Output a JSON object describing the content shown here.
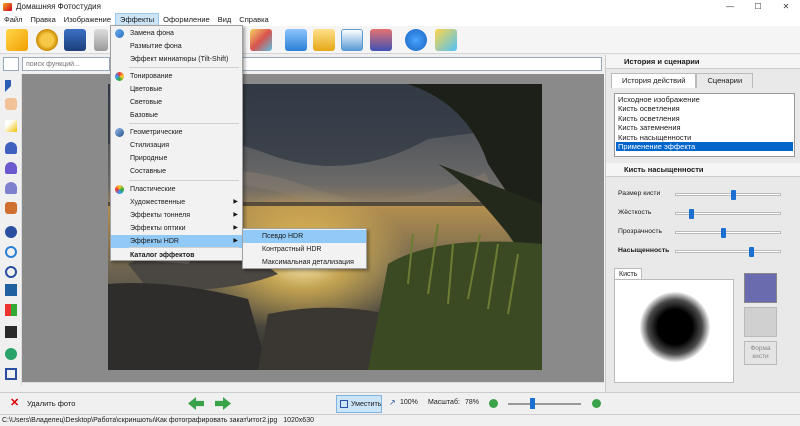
{
  "window": {
    "title": "Домашняя Фотостудия",
    "buttons": [
      "—",
      "☐",
      "✕"
    ]
  },
  "menu": {
    "items": [
      "Файл",
      "Правка",
      "Изображение",
      "Эффекты",
      "Оформление",
      "Вид",
      "Справка"
    ],
    "active_index": 3
  },
  "search": {
    "placeholder": "поиск функций..."
  },
  "effects_menu": {
    "items": [
      {
        "label": "Замена фона",
        "has_sub": false
      },
      {
        "label": "Размытие фона",
        "has_sub": false
      },
      {
        "label": "Эффект миниатюры (Tilt-Shift)",
        "has_sub": false
      },
      {
        "label": "Тонирование",
        "has_sub": false
      },
      {
        "label": "Цветовые",
        "has_sub": false
      },
      {
        "label": "Световые",
        "has_sub": false
      },
      {
        "label": "Базовые",
        "has_sub": false
      },
      {
        "label": "Геометрические",
        "has_sub": false
      },
      {
        "label": "Стилизация",
        "has_sub": false
      },
      {
        "label": "Природные",
        "has_sub": false
      },
      {
        "label": "Составные",
        "has_sub": false
      },
      {
        "label": "Пластические",
        "has_sub": false
      },
      {
        "label": "Художественные",
        "has_sub": true
      },
      {
        "label": "Эффекты тоннеля",
        "has_sub": true
      },
      {
        "label": "Эффекты оптики",
        "has_sub": true
      },
      {
        "label": "Эффекты HDR",
        "has_sub": true
      },
      {
        "label": "Каталог эффектов",
        "has_sub": false
      }
    ],
    "highlighted": "Эффекты HDR"
  },
  "hdr_submenu": {
    "items": [
      "Псевдо HDR",
      "Контрастный HDR",
      "Максимальная детализация"
    ],
    "highlighted": "Псевдо HDR"
  },
  "right_panel": {
    "history_header": "История и сценарии",
    "tabs": [
      "История действий",
      "Сценарии"
    ],
    "history_items": [
      "Исходное изображение",
      "Кисть осветления",
      "Кисть осветления",
      "Кисть затемнения",
      "Кисть насыщенности",
      "Применение эффекта"
    ],
    "selected_history": 5,
    "brush_header": "Кисть насыщенности",
    "sliders": [
      {
        "label": "Размер кисти",
        "value": 0.54,
        "bold": false
      },
      {
        "label": "Жёсткость",
        "value": 0.13,
        "bold": false
      },
      {
        "label": "Прозрачность",
        "value": 0.45,
        "bold": false
      },
      {
        "label": "Насыщенность",
        "value": 0.72,
        "bold": true
      }
    ],
    "brush_tab": "Кисть",
    "brush_color": "#6a6aaf",
    "form_button": "Форма кисти"
  },
  "bottom": {
    "delete_label": "Удалить фото",
    "fit_label": "Уместить",
    "zoom100_label": "100%",
    "scale_label": "Масштаб:",
    "scale_value": "78%",
    "scale_fraction": 0.32
  },
  "status": {
    "path": "C:\\Users\\Владелец\\Desktop\\Работа\\скриншоты\\Как фотографировать закат\\итог2.jpg",
    "dimensions": "1020x630"
  }
}
